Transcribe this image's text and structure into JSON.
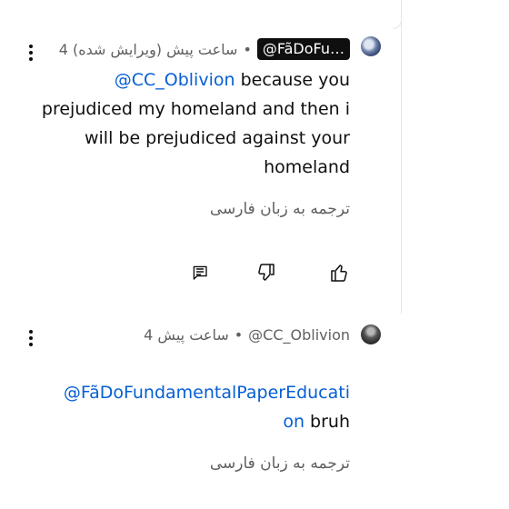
{
  "comments": [
    {
      "author": "@FãDoFu…",
      "separator": "•",
      "time": "4 ساعت پیش (ویرایش شده)",
      "mention": "@CC_Oblivion",
      "text": " because you prejudiced my homeland and then i will be prejudiced against your homeland",
      "translate_label": "ترجمه به زبان فارسی"
    },
    {
      "author": "@CC_Oblivion",
      "separator": "•",
      "time": "4 ساعت پیش",
      "mention": "@FãDoFundamentalPaperEducati on",
      "text": " bruh",
      "translate_label": "ترجمه به زبان فارسی"
    }
  ],
  "icons": {
    "reply": "reply-icon",
    "dislike": "dislike-icon",
    "like": "like-icon",
    "menu": "more-vert-icon"
  }
}
